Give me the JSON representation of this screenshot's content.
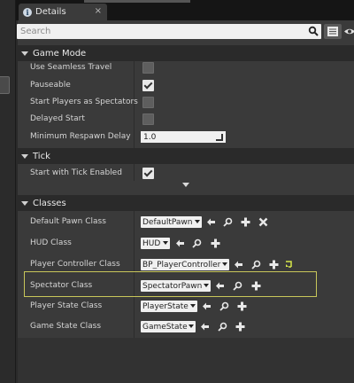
{
  "tab": {
    "title": "Details",
    "close": "×"
  },
  "search": {
    "placeholder": "Search",
    "value": ""
  },
  "sections": {
    "game_mode": {
      "title": "Game Mode",
      "use_seamless_travel": {
        "label": "Use Seamless Travel",
        "checked": false
      },
      "pauseable": {
        "label": "Pauseable",
        "checked": true
      },
      "start_players_as_spectators": {
        "label": "Start Players as Spectators",
        "checked": false
      },
      "delayed_start": {
        "label": "Delayed Start",
        "checked": false
      },
      "minimum_respawn_delay": {
        "label": "Minimum Respawn Delay",
        "value": "1.0"
      }
    },
    "tick": {
      "title": "Tick",
      "start_with_tick_enabled": {
        "label": "Start with Tick Enabled",
        "checked": true
      }
    },
    "classes": {
      "title": "Classes",
      "default_pawn_class": {
        "label": "Default Pawn Class",
        "value": "DefaultPawn"
      },
      "hud_class": {
        "label": "HUD Class",
        "value": "HUD"
      },
      "player_controller_class": {
        "label": "Player Controller Class",
        "value": "BP_PlayerController"
      },
      "spectator_class": {
        "label": "Spectator Class",
        "value": "SpectatorPawn"
      },
      "player_state_class": {
        "label": "Player State Class",
        "value": "PlayerState"
      },
      "game_state_class": {
        "label": "Game State Class",
        "value": "GameState"
      }
    }
  },
  "colors": {
    "panel_bg": "#3a3a3a",
    "category_bg": "#2a2a2a",
    "highlight_border": "#c8c65a",
    "browse_icon": "#d7e84a"
  },
  "icons": [
    "info-icon",
    "search-icon",
    "list-view-icon",
    "eye-icon",
    "use-selected-arrow-icon",
    "browse-magnifier-icon",
    "add-plus-icon",
    "clear-x-icon",
    "browse-to-asset-icon",
    "dropdown-arrow-icon"
  ]
}
